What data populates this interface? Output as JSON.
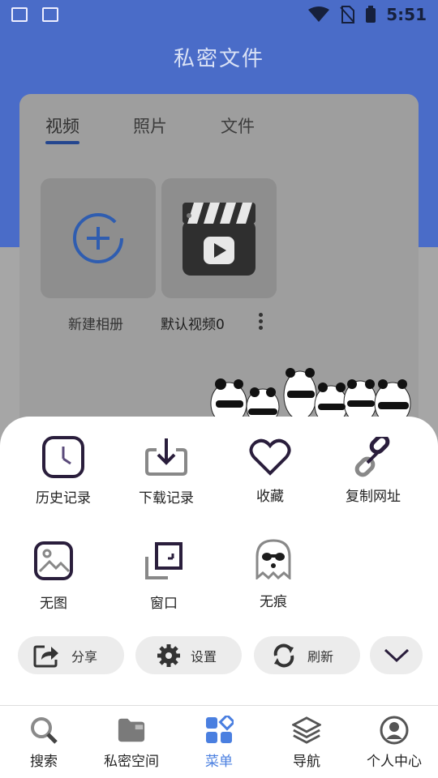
{
  "status_bar": {
    "time": "5:51"
  },
  "header": {
    "title": "私密文件"
  },
  "tabs": [
    {
      "label": "视频",
      "active": true
    },
    {
      "label": "照片",
      "active": false
    },
    {
      "label": "文件",
      "active": false
    }
  ],
  "albums": [
    {
      "label": "新建相册",
      "icon": "add-circle-icon"
    },
    {
      "label": "默认视频0",
      "icon": "clapperboard-icon"
    }
  ],
  "menu": {
    "row1": [
      {
        "label": "历史记录",
        "icon": "clock-icon"
      },
      {
        "label": "下载记录",
        "icon": "download-icon"
      },
      {
        "label": "收藏",
        "icon": "heart-icon"
      },
      {
        "label": "复制网址",
        "icon": "link-icon"
      }
    ],
    "row2": [
      {
        "label": "无图",
        "icon": "image-icon"
      },
      {
        "label": "窗口",
        "icon": "window-icon"
      },
      {
        "label": "无痕",
        "icon": "ghost-icon"
      }
    ],
    "actions": [
      {
        "label": "分享",
        "icon": "share-icon"
      },
      {
        "label": "设置",
        "icon": "gear-icon"
      },
      {
        "label": "刷新",
        "icon": "refresh-icon"
      }
    ]
  },
  "bottom_nav": [
    {
      "label": "搜索",
      "icon": "search-icon",
      "active": false
    },
    {
      "label": "私密空间",
      "icon": "folder-icon",
      "active": false
    },
    {
      "label": "菜单",
      "icon": "grid-icon",
      "active": true
    },
    {
      "label": "导航",
      "icon": "layers-icon",
      "active": false
    },
    {
      "label": "个人中心",
      "icon": "user-icon",
      "active": false
    }
  ],
  "colors": {
    "brand_blue": "#4a6cc8",
    "active_nav": "#4a7fe0",
    "icon_dark": "#2a1e3c"
  }
}
